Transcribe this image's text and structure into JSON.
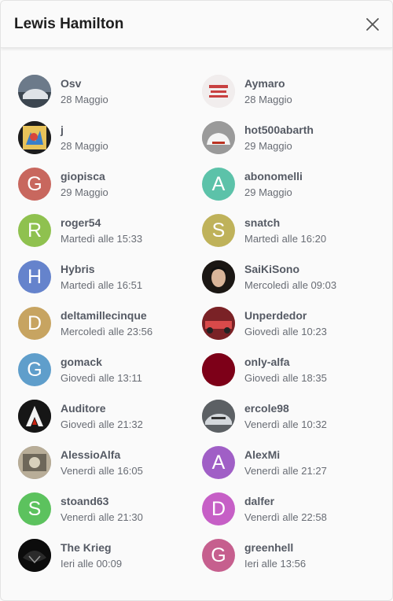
{
  "dialog": {
    "title": "Lewis Hamilton",
    "close_icon": "close-icon"
  },
  "users": [
    {
      "name": "Osv",
      "time": "28 Maggio",
      "avatar": {
        "type": "photo",
        "bg": "#5a6878"
      }
    },
    {
      "name": "Aymaro",
      "time": "28 Maggio",
      "avatar": {
        "type": "photo",
        "bg": "#e9e4e4"
      }
    },
    {
      "name": "j",
      "time": "28 Maggio",
      "avatar": {
        "type": "photo",
        "bg": "#1d1d1d"
      }
    },
    {
      "name": "hot500abarth",
      "time": "29 Maggio",
      "avatar": {
        "type": "photo",
        "bg": "#8d8d8d"
      }
    },
    {
      "name": "giopisca",
      "time": "29 Maggio",
      "avatar": {
        "type": "letter",
        "letter": "G",
        "bg": "#c8675e"
      }
    },
    {
      "name": "abonomelli",
      "time": "29 Maggio",
      "avatar": {
        "type": "letter",
        "letter": "A",
        "bg": "#5cc2a9"
      }
    },
    {
      "name": "roger54",
      "time": "Martedì alle 15:33",
      "avatar": {
        "type": "letter",
        "letter": "R",
        "bg": "#8fc14f"
      }
    },
    {
      "name": "snatch",
      "time": "Martedì alle 16:20",
      "avatar": {
        "type": "letter",
        "letter": "S",
        "bg": "#bfb25a"
      }
    },
    {
      "name": "Hybris",
      "time": "Martedì alle 16:51",
      "avatar": {
        "type": "letter",
        "letter": "H",
        "bg": "#6583cc"
      }
    },
    {
      "name": "SaiKiSono",
      "time": "Mercoledì alle 09:03",
      "avatar": {
        "type": "photo",
        "bg": "#2b2320"
      }
    },
    {
      "name": "deltamillecinque",
      "time": "Mercoledì alle 23:56",
      "avatar": {
        "type": "letter",
        "letter": "D",
        "bg": "#c7a461"
      }
    },
    {
      "name": "Unperdedor",
      "time": "Giovedì alle 10:23",
      "avatar": {
        "type": "photo",
        "bg": "#9c2a2e"
      }
    },
    {
      "name": "gomack",
      "time": "Giovedì alle 13:11",
      "avatar": {
        "type": "letter",
        "letter": "G",
        "bg": "#5f9ecb"
      }
    },
    {
      "name": "only-alfa",
      "time": "Giovedì alle 18:35",
      "avatar": {
        "type": "photo",
        "bg": "#7d0018"
      }
    },
    {
      "name": "Auditore",
      "time": "Giovedì alle 21:32",
      "avatar": {
        "type": "photo",
        "bg": "#161616"
      }
    },
    {
      "name": "ercole98",
      "time": "Venerdì alle 10:32",
      "avatar": {
        "type": "photo",
        "bg": "#707478"
      }
    },
    {
      "name": "AlessioAlfa",
      "time": "Venerdì alle 16:05",
      "avatar": {
        "type": "photo",
        "bg": "#8a8070"
      }
    },
    {
      "name": "AlexMi",
      "time": "Venerdì alle 21:27",
      "avatar": {
        "type": "letter",
        "letter": "A",
        "bg": "#a05fc6"
      }
    },
    {
      "name": "stoand63",
      "time": "Venerdì alle 21:30",
      "avatar": {
        "type": "letter",
        "letter": "S",
        "bg": "#5cc25e"
      }
    },
    {
      "name": "dalfer",
      "time": "Venerdì alle 22:58",
      "avatar": {
        "type": "letter",
        "letter": "D",
        "bg": "#c65fc6"
      }
    },
    {
      "name": "The Krieg",
      "time": "Ieri alle 00:09",
      "avatar": {
        "type": "photo",
        "bg": "#0c0c0c"
      }
    },
    {
      "name": "greenhell",
      "time": "Ieri alle 13:56",
      "avatar": {
        "type": "letter",
        "letter": "G",
        "bg": "#c65f8e"
      }
    }
  ]
}
